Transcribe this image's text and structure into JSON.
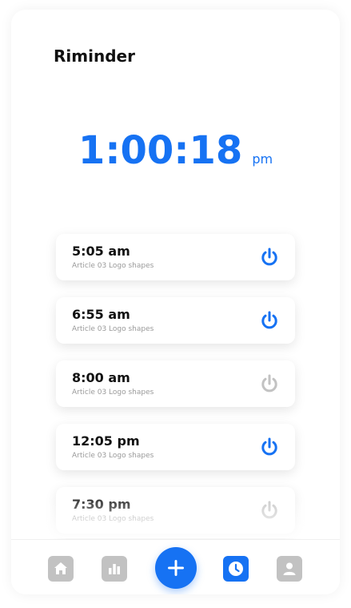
{
  "app": {
    "title": "Riminder"
  },
  "clock": {
    "time": "1:00:18",
    "ampm": "pm"
  },
  "colors": {
    "accent": "#1672f3",
    "inactive": "#c2c2c2"
  },
  "reminders": [
    {
      "time": "5:05 am",
      "label": "Article 03 Logo shapes",
      "enabled": true
    },
    {
      "time": "6:55 am",
      "label": "Article 03 Logo shapes",
      "enabled": true
    },
    {
      "time": "8:00 am",
      "label": "Article 03 Logo shapes",
      "enabled": false
    },
    {
      "time": "12:05 pm",
      "label": "Article 03 Logo shapes",
      "enabled": true
    },
    {
      "time": "7:30 pm",
      "label": "Article 03 Logo shapes",
      "enabled": false
    }
  ],
  "nav": {
    "items": [
      {
        "icon": "home-icon",
        "active": false
      },
      {
        "icon": "bar-chart-icon",
        "active": false
      },
      {
        "icon": "plus-icon",
        "active": false
      },
      {
        "icon": "clock-icon",
        "active": true
      },
      {
        "icon": "user-icon",
        "active": false
      }
    ]
  }
}
